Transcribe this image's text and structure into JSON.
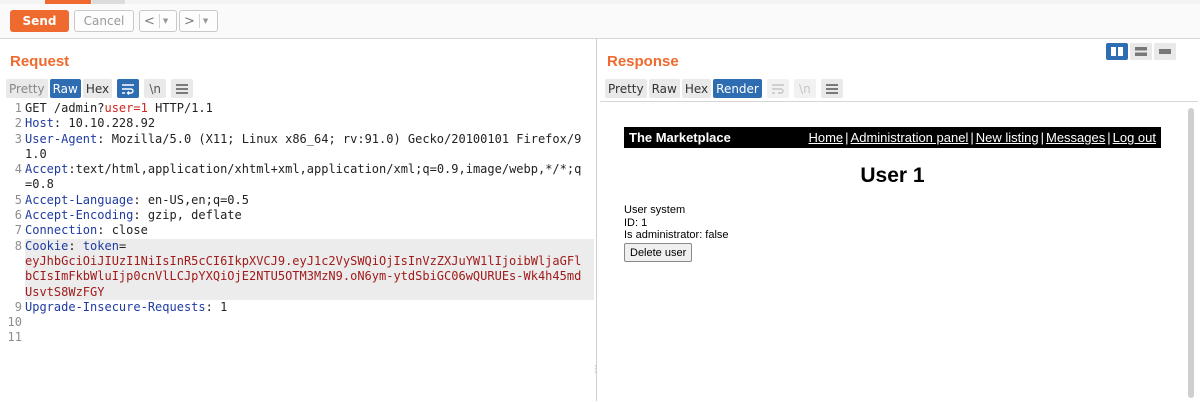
{
  "toolbar": {
    "send_label": "Send",
    "cancel_label": "Cancel",
    "prev_label": "<",
    "next_label": ">",
    "dropdown_glyph": "▼"
  },
  "colors": {
    "accent": "#ee6a2e",
    "active_blue": "#2f6db2"
  },
  "request": {
    "title": "Request",
    "tabs": [
      "Pretty",
      "Raw",
      "Hex"
    ],
    "active_tab": "Raw",
    "newline_label": "\\n",
    "icons": [
      "wrap-lines-icon",
      "newline-icon",
      "menu-icon"
    ],
    "lines": [
      {
        "n": "1",
        "key": "",
        "sep": "",
        "text": "GET /admin?",
        "param": "user=",
        "val": "1",
        "tail": " HTTP/1.1"
      },
      {
        "n": "2",
        "key": "Host",
        "sep": ": ",
        "text": "10.10.228.92"
      },
      {
        "n": "3",
        "key": "User-Agent",
        "sep": ": ",
        "text": "Mozilla/5.0 (X11; Linux x86_64; rv:91.0) Gecko/20100101 Firefox/91.0"
      },
      {
        "n": "4",
        "key": "Accept",
        "sep": ":",
        "text": "text/html,application/xhtml+xml,application/xml;q=0.9,image/webp,*/*;q=0.8"
      },
      {
        "n": "5",
        "key": "Accept-Language",
        "sep": ": ",
        "text": "en-US,en;q=0.5"
      },
      {
        "n": "6",
        "key": "Accept-Encoding",
        "sep": ": ",
        "text": "gzip, deflate"
      },
      {
        "n": "7",
        "key": "Connection",
        "sep": ": ",
        "text": "close"
      },
      {
        "n": "8",
        "key": "Cookie",
        "sep": ": ",
        "ckey": "token",
        "text": "eyJhbGciOiJIUzI1NiIsInR5cCI6IkpXVCJ9.eyJ1c2VySWQiOjIsInVzZXJuYW1lIjoibWljaGFlbCIsImFkbWluIjp0cnVlLCJpYXQiOjE2NTU5OTM3MzN9.oN6ym-ytdSbiGC06wQURUEs-Wk4h45mdUsvtS8WzFGY"
      },
      {
        "n": "9",
        "key": "Upgrade-Insecure-Requests",
        "sep": ": ",
        "text": "1"
      },
      {
        "n": "10",
        "text": ""
      },
      {
        "n": "11",
        "text": ""
      }
    ]
  },
  "response": {
    "title": "Response",
    "tabs": [
      "Pretty",
      "Raw",
      "Hex",
      "Render"
    ],
    "active_tab": "Render",
    "newline_label": "\\n",
    "render": {
      "brand": "The Marketplace",
      "nav": [
        "Home",
        "Administration panel",
        "New listing",
        "Messages",
        "Log out"
      ],
      "heading": "User 1",
      "info": [
        "User system",
        "ID: 1",
        "Is administrator: false"
      ],
      "delete_label": "Delete user"
    }
  }
}
